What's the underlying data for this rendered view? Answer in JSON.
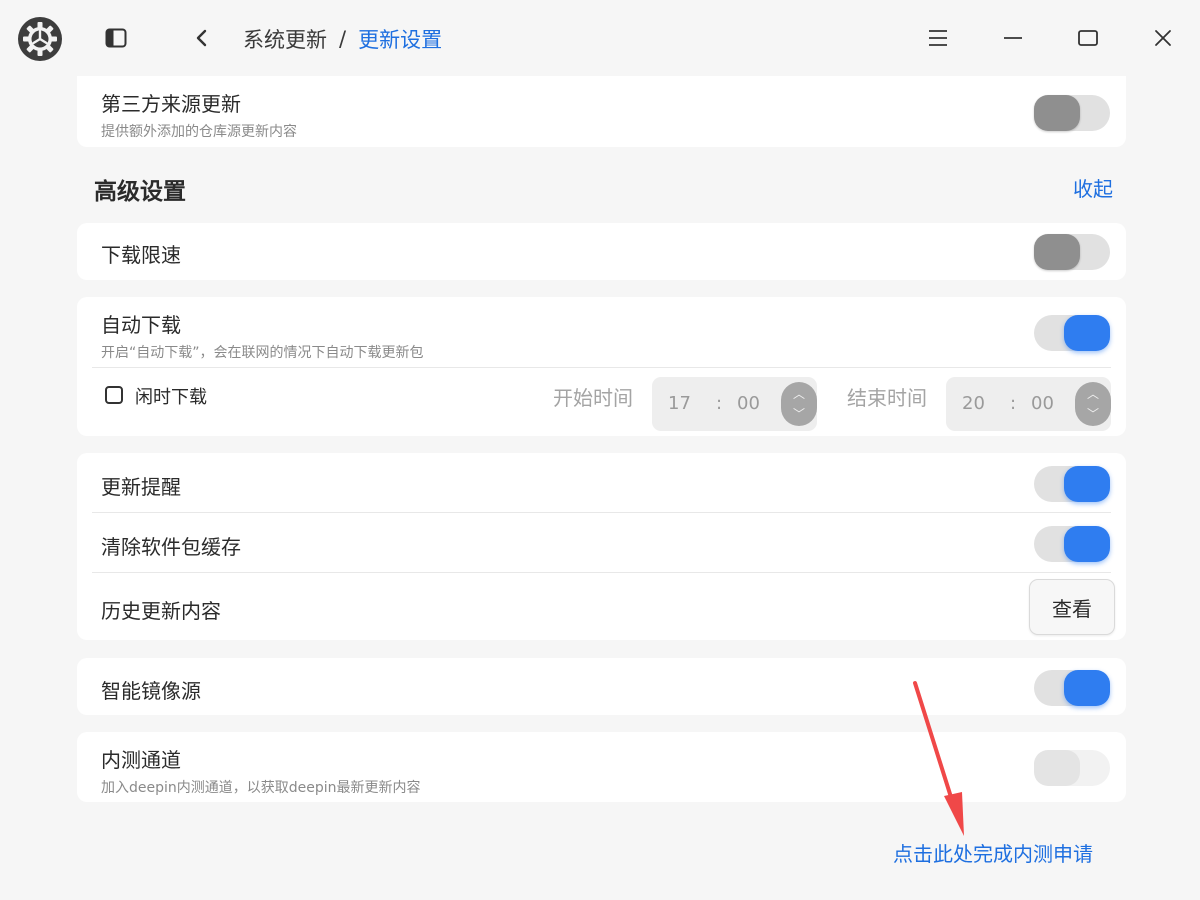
{
  "titlebar": {
    "app_icon": "settings-gear-icon",
    "sidebar_toggle_icon": "sidebar-toggle-icon",
    "back_icon": "chevron-left-icon",
    "breadcrumb": {
      "parent": "系统更新",
      "separator": "/",
      "current": "更新设置"
    },
    "menu_icon": "hamburger-menu-icon",
    "minimize_icon": "minimize-icon",
    "maximize_icon": "maximize-icon",
    "close_icon": "close-icon"
  },
  "third_party": {
    "title": "第三方来源更新",
    "desc": "提供额外添加的仓库源更新内容",
    "enabled": false
  },
  "advanced": {
    "title": "高级设置",
    "collapse_label": "收起"
  },
  "download_limit": {
    "title": "下载限速",
    "enabled": false
  },
  "auto_download": {
    "title": "自动下载",
    "desc": "开启“自动下载”，会在联网的情况下自动下载更新包",
    "enabled": true,
    "idle_label": "闲时下载",
    "idle_checked": false,
    "start_label": "开始时间",
    "start_hour": "17",
    "start_minute": "00",
    "end_label": "结束时间",
    "end_hour": "20",
    "end_minute": "00",
    "time_separator": ":"
  },
  "update_group": {
    "reminder": {
      "title": "更新提醒",
      "enabled": true
    },
    "clear_cache": {
      "title": "清除软件包缓存",
      "enabled": true
    },
    "history": {
      "title": "历史更新内容",
      "button": "查看"
    }
  },
  "smart_mirror": {
    "title": "智能镜像源",
    "enabled": true
  },
  "beta_channel": {
    "title": "内测通道",
    "desc": "加入deepin内测通道，以获取deepin最新更新内容",
    "enabled": false,
    "disabled": true
  },
  "beta_link": "点击此处完成内测申请",
  "colors": {
    "accent": "#1e6fe0",
    "toggle_on": "#2f7df0",
    "annotation_arrow": "#f04848"
  }
}
